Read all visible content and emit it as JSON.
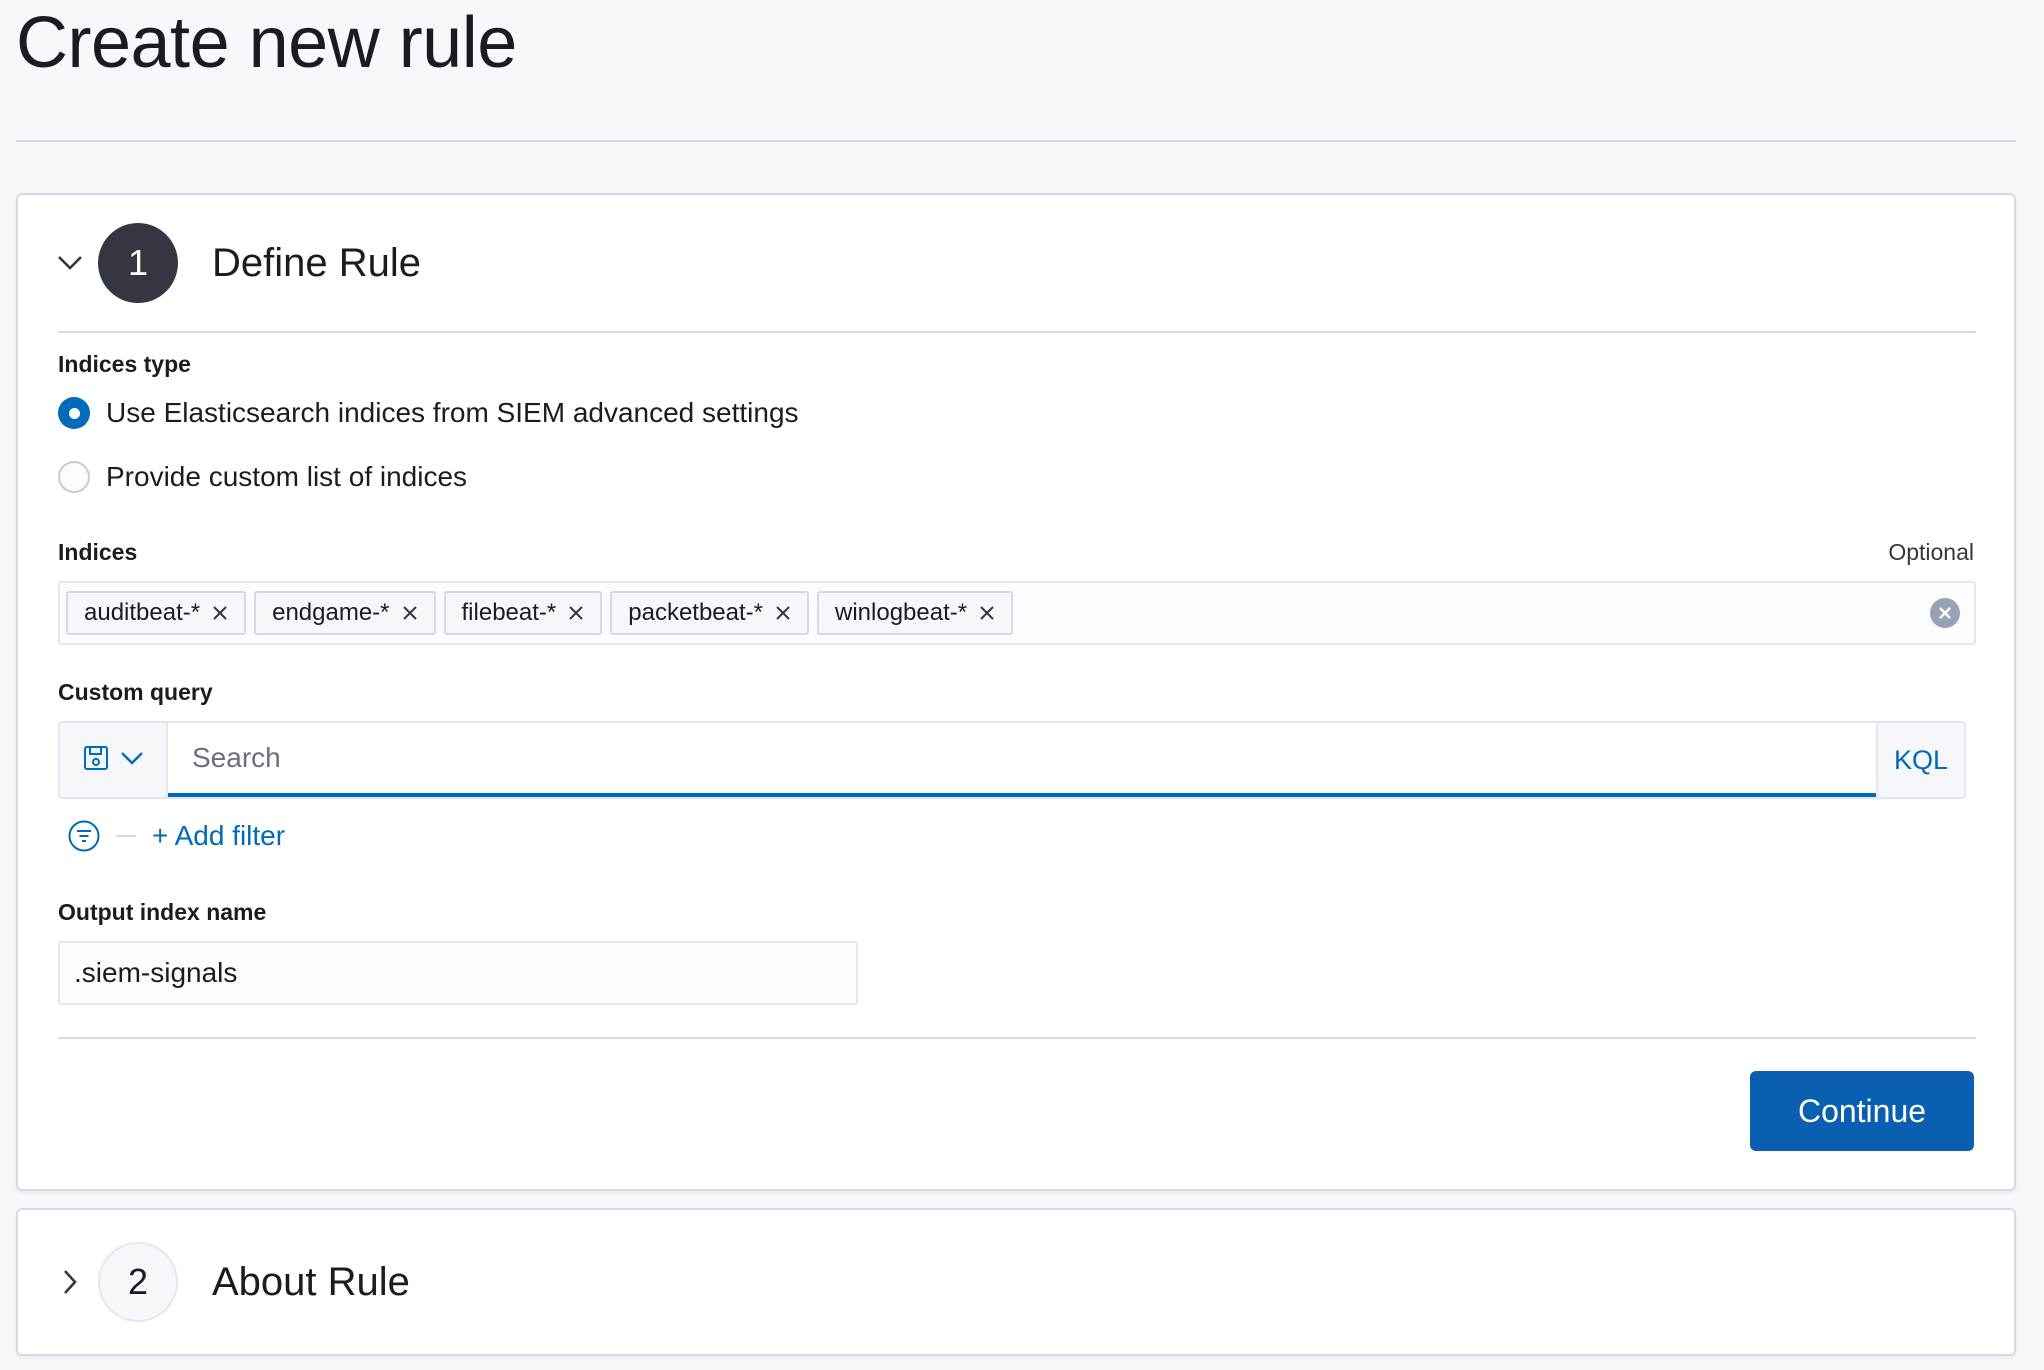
{
  "page": {
    "title": "Create new rule"
  },
  "steps": [
    {
      "number": "1",
      "title": "Define Rule",
      "expanded": true,
      "chevron_icon": "chevron-down-icon"
    },
    {
      "number": "2",
      "title": "About Rule",
      "expanded": false,
      "chevron_icon": "chevron-right-icon"
    }
  ],
  "define_rule": {
    "indices_type": {
      "label": "Indices type",
      "options": [
        {
          "label": "Use Elasticsearch indices from SIEM advanced settings",
          "checked": true
        },
        {
          "label": "Provide custom list of indices",
          "checked": false
        }
      ]
    },
    "indices": {
      "label": "Indices",
      "optional_label": "Optional",
      "values": [
        "auditbeat-*",
        "endgame-*",
        "filebeat-*",
        "packetbeat-*",
        "winlogbeat-*"
      ],
      "remove_icon": "close-icon",
      "clear_icon": "clear-circle-icon"
    },
    "custom_query": {
      "label": "Custom query",
      "saved_query_icon": "save-icon",
      "search_placeholder": "Search",
      "search_value": "",
      "language_label": "KQL",
      "filter_icon": "filter-icon",
      "add_filter_label": "+ Add filter"
    },
    "output_index": {
      "label": "Output index name",
      "value": ".siem-signals"
    },
    "continue_label": "Continue"
  },
  "colors": {
    "primary": "#006bb8",
    "button": "#0b5fb0",
    "step_active": "#343741",
    "border": "#d3dae6",
    "background": "#f7f8fb"
  }
}
